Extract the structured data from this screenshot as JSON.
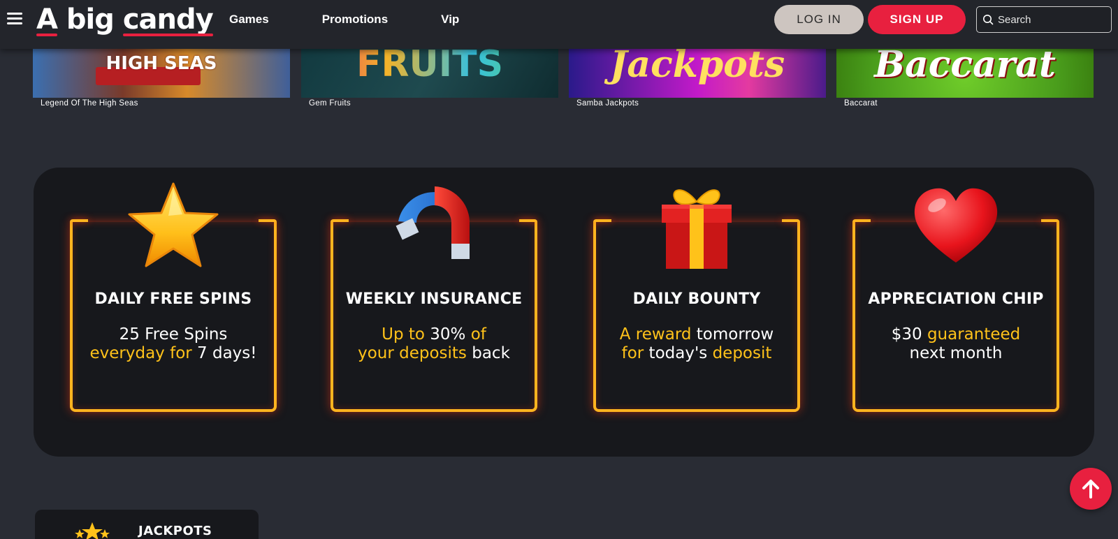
{
  "header": {
    "logo": [
      "A",
      "big",
      "candy"
    ],
    "nav": [
      "Games",
      "Promotions",
      "Vip"
    ],
    "login_label": "LOG IN",
    "signup_label": "SIGN UP",
    "search_placeholder": "Search"
  },
  "games": [
    {
      "name": "Legend Of The High Seas",
      "art_text": "HIGH SEAS"
    },
    {
      "name": "Gem Fruits",
      "art_text": "FRUITS"
    },
    {
      "name": "Samba Jackpots",
      "art_text": "Jackpots"
    },
    {
      "name": "Baccarat",
      "art_text": "Baccarat"
    }
  ],
  "promos": [
    {
      "icon": "star-icon",
      "title": "DAILY FREE SPINS",
      "line1": [
        {
          "t": "25 Free Spins",
          "hl": false
        }
      ],
      "line2": [
        {
          "t": "everyday for",
          "hl": true
        },
        {
          "t": " 7 days!",
          "hl": false
        }
      ]
    },
    {
      "icon": "magnet-icon",
      "title": "WEEKLY INSURANCE",
      "line1": [
        {
          "t": "Up to",
          "hl": true
        },
        {
          "t": " 30% ",
          "hl": false
        },
        {
          "t": "of",
          "hl": true
        }
      ],
      "line2": [
        {
          "t": "your deposits",
          "hl": true
        },
        {
          "t": " back",
          "hl": false
        }
      ]
    },
    {
      "icon": "gift-icon",
      "title": "DAILY BOUNTY",
      "line1": [
        {
          "t": "A reward",
          "hl": true
        },
        {
          "t": " tomorrow",
          "hl": false
        }
      ],
      "line2": [
        {
          "t": "for",
          "hl": true
        },
        {
          "t": " today's ",
          "hl": false
        },
        {
          "t": "deposit",
          "hl": true
        }
      ]
    },
    {
      "icon": "heart-icon",
      "title": "APPRECIATION CHIP",
      "line1": [
        {
          "t": "$30 ",
          "hl": false
        },
        {
          "t": "guaranteed",
          "hl": true
        }
      ],
      "line2": [
        {
          "t": "next month",
          "hl": false
        }
      ]
    }
  ],
  "jackpots_label": "JACKPOTS",
  "colors": {
    "accent": "#e8203f",
    "highlight": "#ffc21a",
    "neon_border": "#ffb41f"
  }
}
